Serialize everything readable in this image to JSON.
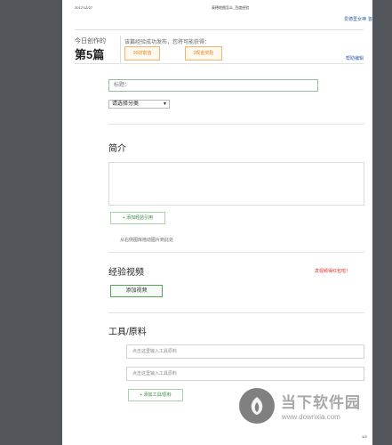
{
  "header": {
    "date": "2017/12/27",
    "doc_title": "高德地图怎么_百度经验",
    "user_link": "爱德里女神",
    "menu_link": "首"
  },
  "stats": {
    "today_label": "今日创作的",
    "count": "第5篇",
    "promo": "该篇经验成功发布，您将可能获得：",
    "badge_wealth": "20财富值",
    "badge_reward": "3现金奖励",
    "help_link": "帮助编辑"
  },
  "form": {
    "title_placeholder": "标题：",
    "category_select": "请选择分类"
  },
  "intro": {
    "heading": "简介",
    "add_reference": "+ 添加经验引用",
    "hint": "从右侧图库拖动图片到此处"
  },
  "video": {
    "heading": "经验视频",
    "red_link": "发视频得红包啦！",
    "add_video": "添加视频"
  },
  "tools": {
    "heading": "工具/原料",
    "placeholders": [
      "点击这里输入工具原料",
      "点击这里输入工具原料"
    ],
    "add_tool": "+ 添加工具/原料"
  },
  "footer": {
    "page_num": "1/3"
  },
  "watermark": {
    "brand": "当下软件园",
    "url": "www.downxia.com"
  },
  "colors": {
    "bg": "#53565b",
    "accent_green": "#3a8a3a",
    "badge_orange": "#e08a2b",
    "link_blue": "#2a5ea8",
    "link_red": "#e0302a"
  }
}
